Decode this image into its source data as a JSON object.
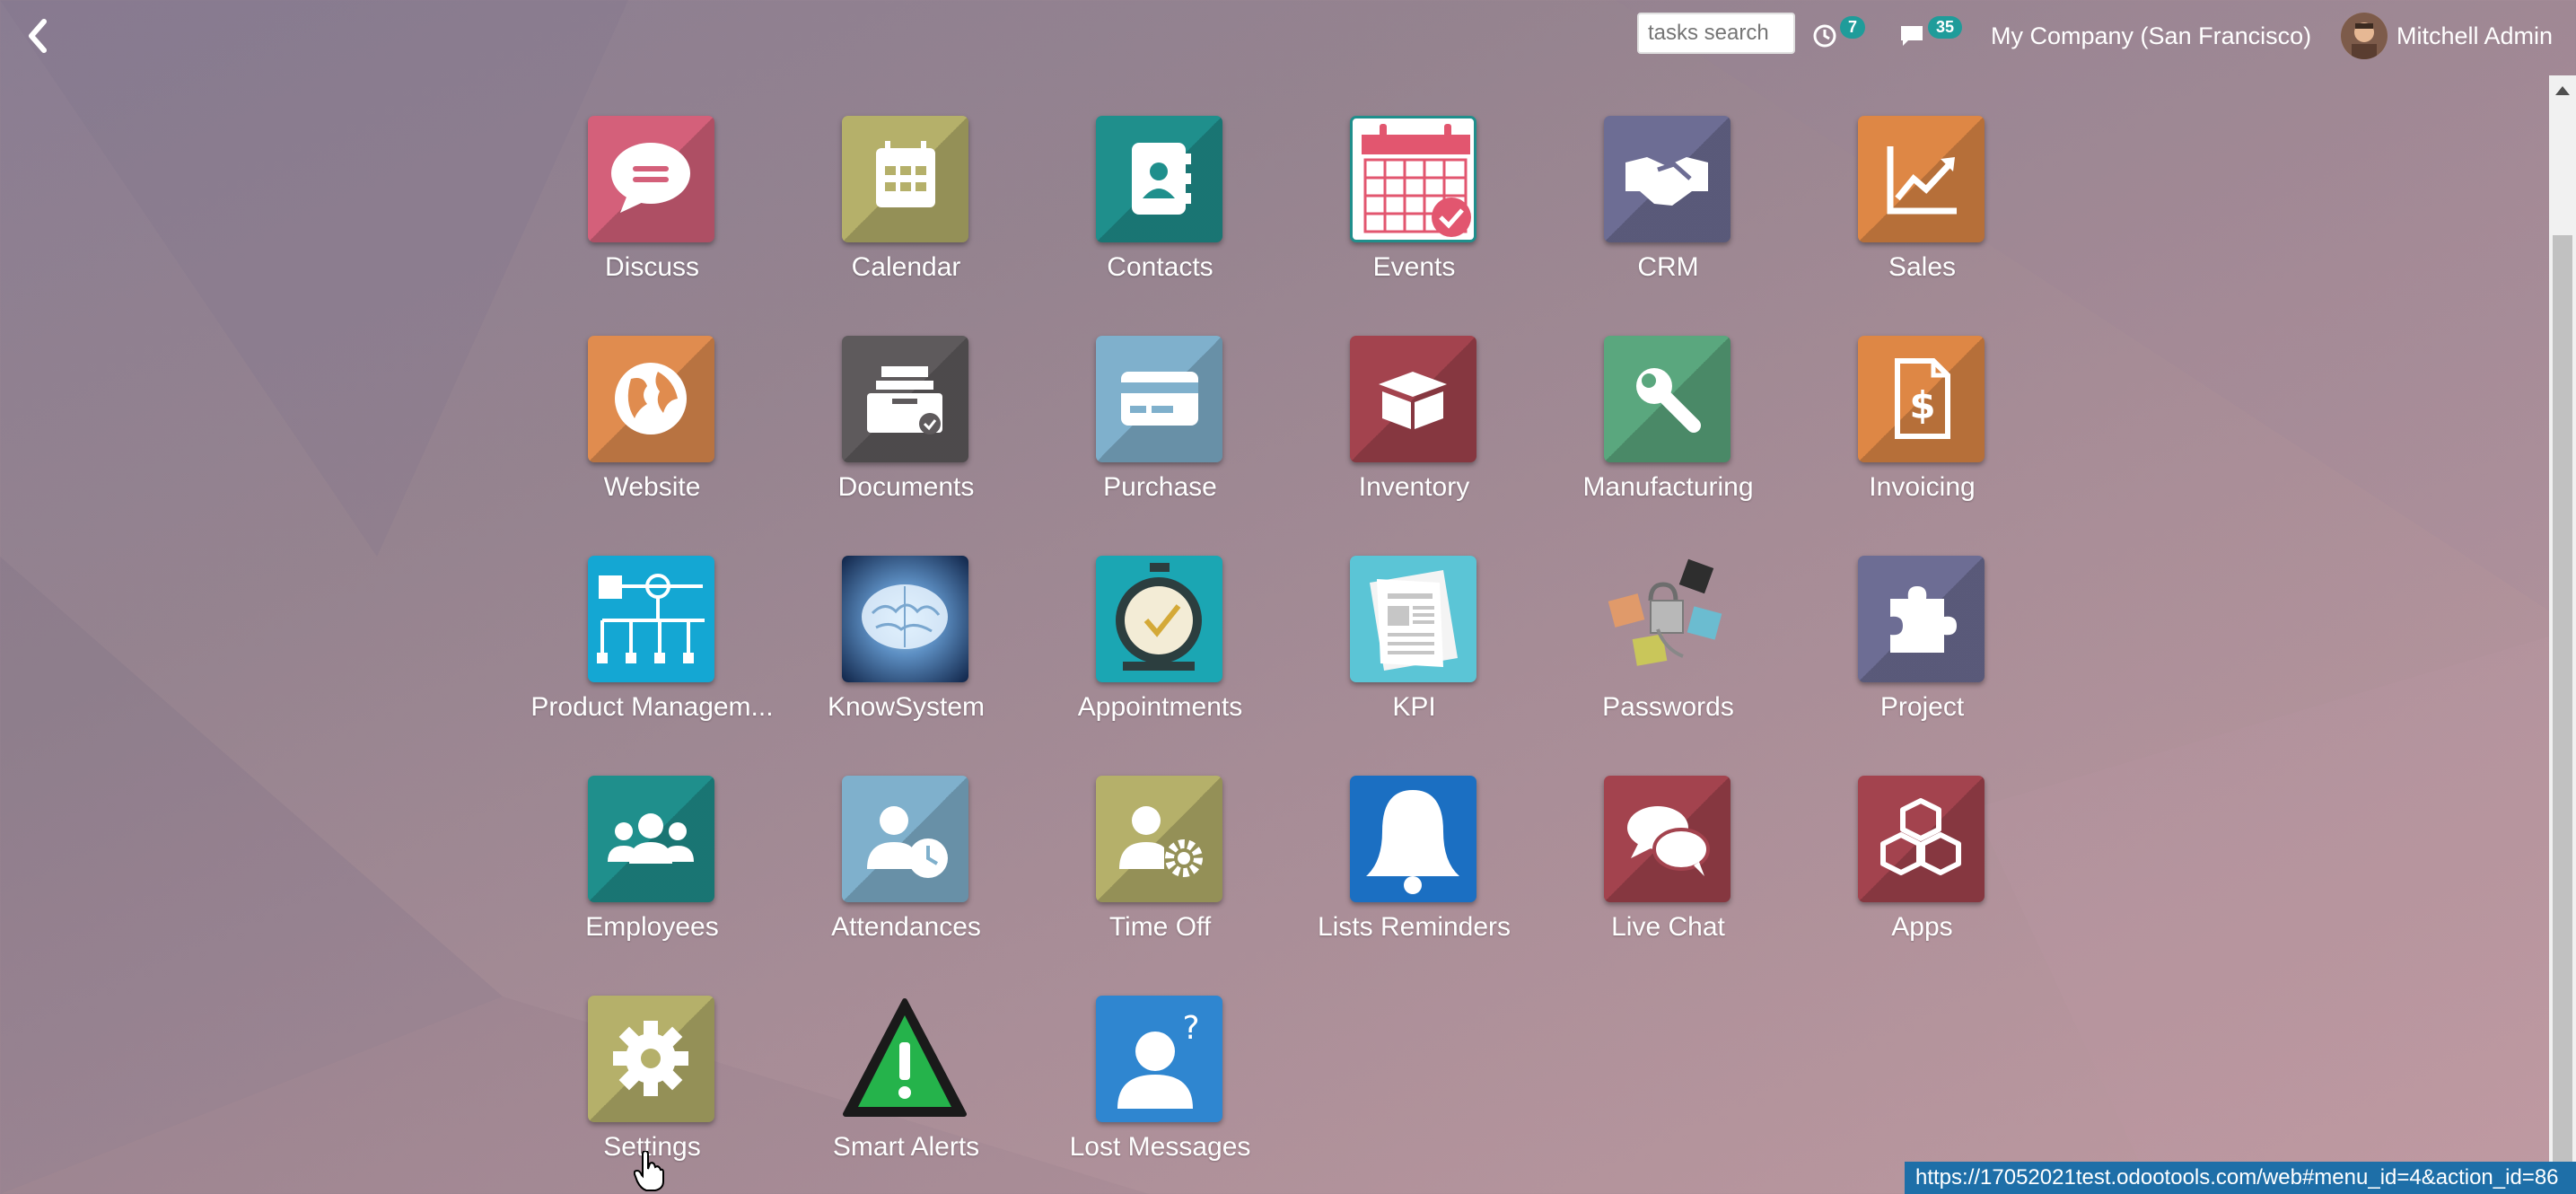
{
  "topbar": {
    "search_placeholder": "tasks search",
    "activity_count": "7",
    "messages_count": "35",
    "company": "My Company (San Francisco)",
    "user": "Mitchell Admin"
  },
  "apps": [
    {
      "label": "Discuss",
      "icon": "chat-bubble-icon",
      "color": "#d4607a"
    },
    {
      "label": "Calendar",
      "icon": "calendar-icon",
      "color": "#b5b06a"
    },
    {
      "label": "Contacts",
      "icon": "address-book-icon",
      "color": "#1f8f8c"
    },
    {
      "label": "Events",
      "icon": "event-calendar-icon",
      "color": "#ffffff"
    },
    {
      "label": "CRM",
      "icon": "handshake-icon",
      "color": "#6d6d94"
    },
    {
      "label": "Sales",
      "icon": "trend-chart-icon",
      "color": "#de8745"
    },
    {
      "label": "Website",
      "icon": "globe-icon",
      "color": "#e08c4f"
    },
    {
      "label": "Documents",
      "icon": "archive-box-icon",
      "color": "#5e5a5c"
    },
    {
      "label": "Purchase",
      "icon": "credit-card-icon",
      "color": "#7fb0cc"
    },
    {
      "label": "Inventory",
      "icon": "open-box-icon",
      "color": "#a3434e"
    },
    {
      "label": "Manufacturing",
      "icon": "wrench-icon",
      "color": "#5aa77e"
    },
    {
      "label": "Invoicing",
      "icon": "invoice-dollar-icon",
      "color": "#de8745"
    },
    {
      "label": "Product Managem...",
      "icon": "org-chart-icon",
      "color": "#14a7d3"
    },
    {
      "label": "KnowSystem",
      "icon": "brain-icon",
      "color": "#1d3a66"
    },
    {
      "label": "Appointments",
      "icon": "stopwatch-icon",
      "color": "#1ba6b3"
    },
    {
      "label": "KPI",
      "icon": "newspaper-icon",
      "color": "#5bc5d6"
    },
    {
      "label": "Passwords",
      "icon": "padlocks-icon",
      "color": "transparent"
    },
    {
      "label": "Project",
      "icon": "puzzle-icon",
      "color": "#6d6d94"
    },
    {
      "label": "Employees",
      "icon": "people-group-icon",
      "color": "#1f8f8c"
    },
    {
      "label": "Attendances",
      "icon": "user-clock-icon",
      "color": "#7fb0cc"
    },
    {
      "label": "Time Off",
      "icon": "user-gear-icon",
      "color": "#b5b06a"
    },
    {
      "label": "Lists Reminders",
      "icon": "bell-icon",
      "color": "#1b6fc2"
    },
    {
      "label": "Live Chat",
      "icon": "chat-bubbles-icon",
      "color": "#a3434e"
    },
    {
      "label": "Apps",
      "icon": "cubes-icon",
      "color": "#a3434e"
    },
    {
      "label": "Settings",
      "icon": "gear-icon",
      "color": "#b5b06a"
    },
    {
      "label": "Smart Alerts",
      "icon": "warning-triangle-icon",
      "color": "transparent"
    },
    {
      "label": "Lost Messages",
      "icon": "user-question-icon",
      "color": "#2f86d0"
    }
  ],
  "status_url": "https://17052021test.odootools.com/web#menu_id=4&action_id=86"
}
